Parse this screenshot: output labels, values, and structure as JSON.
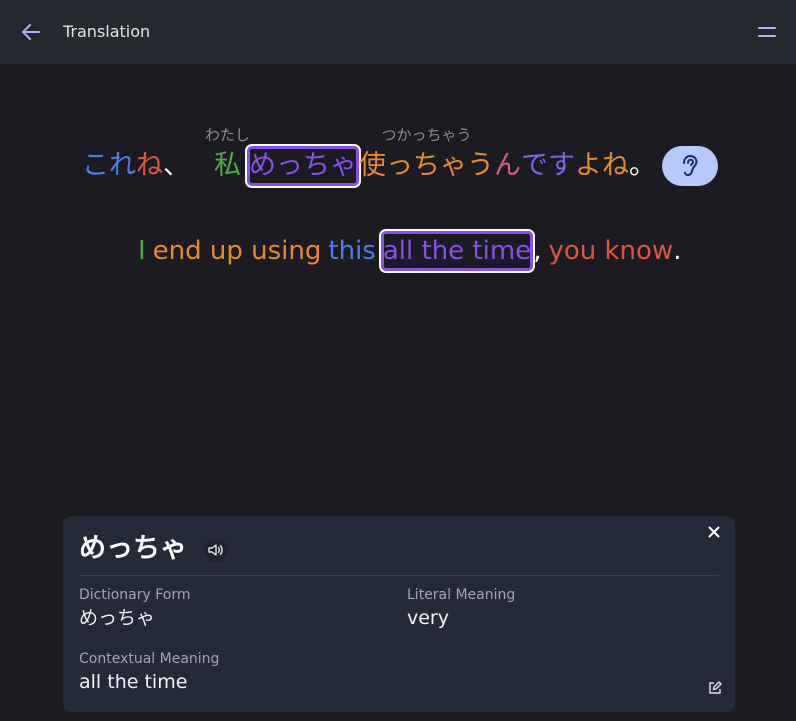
{
  "header": {
    "title": "Translation",
    "back_icon": "arrow-left-icon",
    "menu_icon": "menu-icon"
  },
  "colors": {
    "blue": "#4e7ee8",
    "red": "#e0553f",
    "green": "#53a94a",
    "orange": "#e68a2e",
    "purple": "#8a4ff0",
    "pink": "#d65a8e",
    "violet": "#7b6ae8",
    "white": "#ffffff",
    "listen_bg": "#b8c8fb"
  },
  "japanese": {
    "tokens": [
      {
        "text": "これ",
        "color": "#4e7ee8"
      },
      {
        "text": "ね",
        "color": "#e0553f"
      },
      {
        "text": "、",
        "color": "#ffffff"
      },
      {
        "text": "私",
        "color": "#53a94a",
        "reading": "わたし"
      },
      {
        "text": "めっちゃ",
        "color": "#8a4ff0",
        "selected": true
      },
      {
        "text": "使っちゃう",
        "color": "#e68a2e",
        "reading": "つかっちゃう"
      },
      {
        "text": "ん",
        "color": "#d65a8e"
      },
      {
        "text": "です",
        "color": "#7b6ae8"
      },
      {
        "text": "よね",
        "color": "#e68a2e"
      },
      {
        "text": "。",
        "color": "#ffffff"
      }
    ],
    "listen_icon": "ear-icon"
  },
  "english": {
    "tokens": [
      {
        "text": "I",
        "color": "#53a94a"
      },
      {
        "text": "end up using",
        "color": "#e68a2e"
      },
      {
        "text": "this",
        "color": "#4e7ee8"
      },
      {
        "text": "all the time",
        "color": "#8a4ff0",
        "selected": true
      },
      {
        "text": ",",
        "color": "#ffffff"
      },
      {
        "text": "you know",
        "color": "#e0553f"
      },
      {
        "text": ".",
        "color": "#ffffff"
      }
    ]
  },
  "detail": {
    "word": "めっちゃ",
    "speaker_icon": "speaker-icon",
    "close_icon": "close-icon",
    "edit_icon": "edit-icon",
    "dictionary_form_label": "Dictionary Form",
    "dictionary_form_value": "めっちゃ",
    "literal_meaning_label": "Literal Meaning",
    "literal_meaning_value": "very",
    "contextual_meaning_label": "Contextual Meaning",
    "contextual_meaning_value": "all the time"
  }
}
